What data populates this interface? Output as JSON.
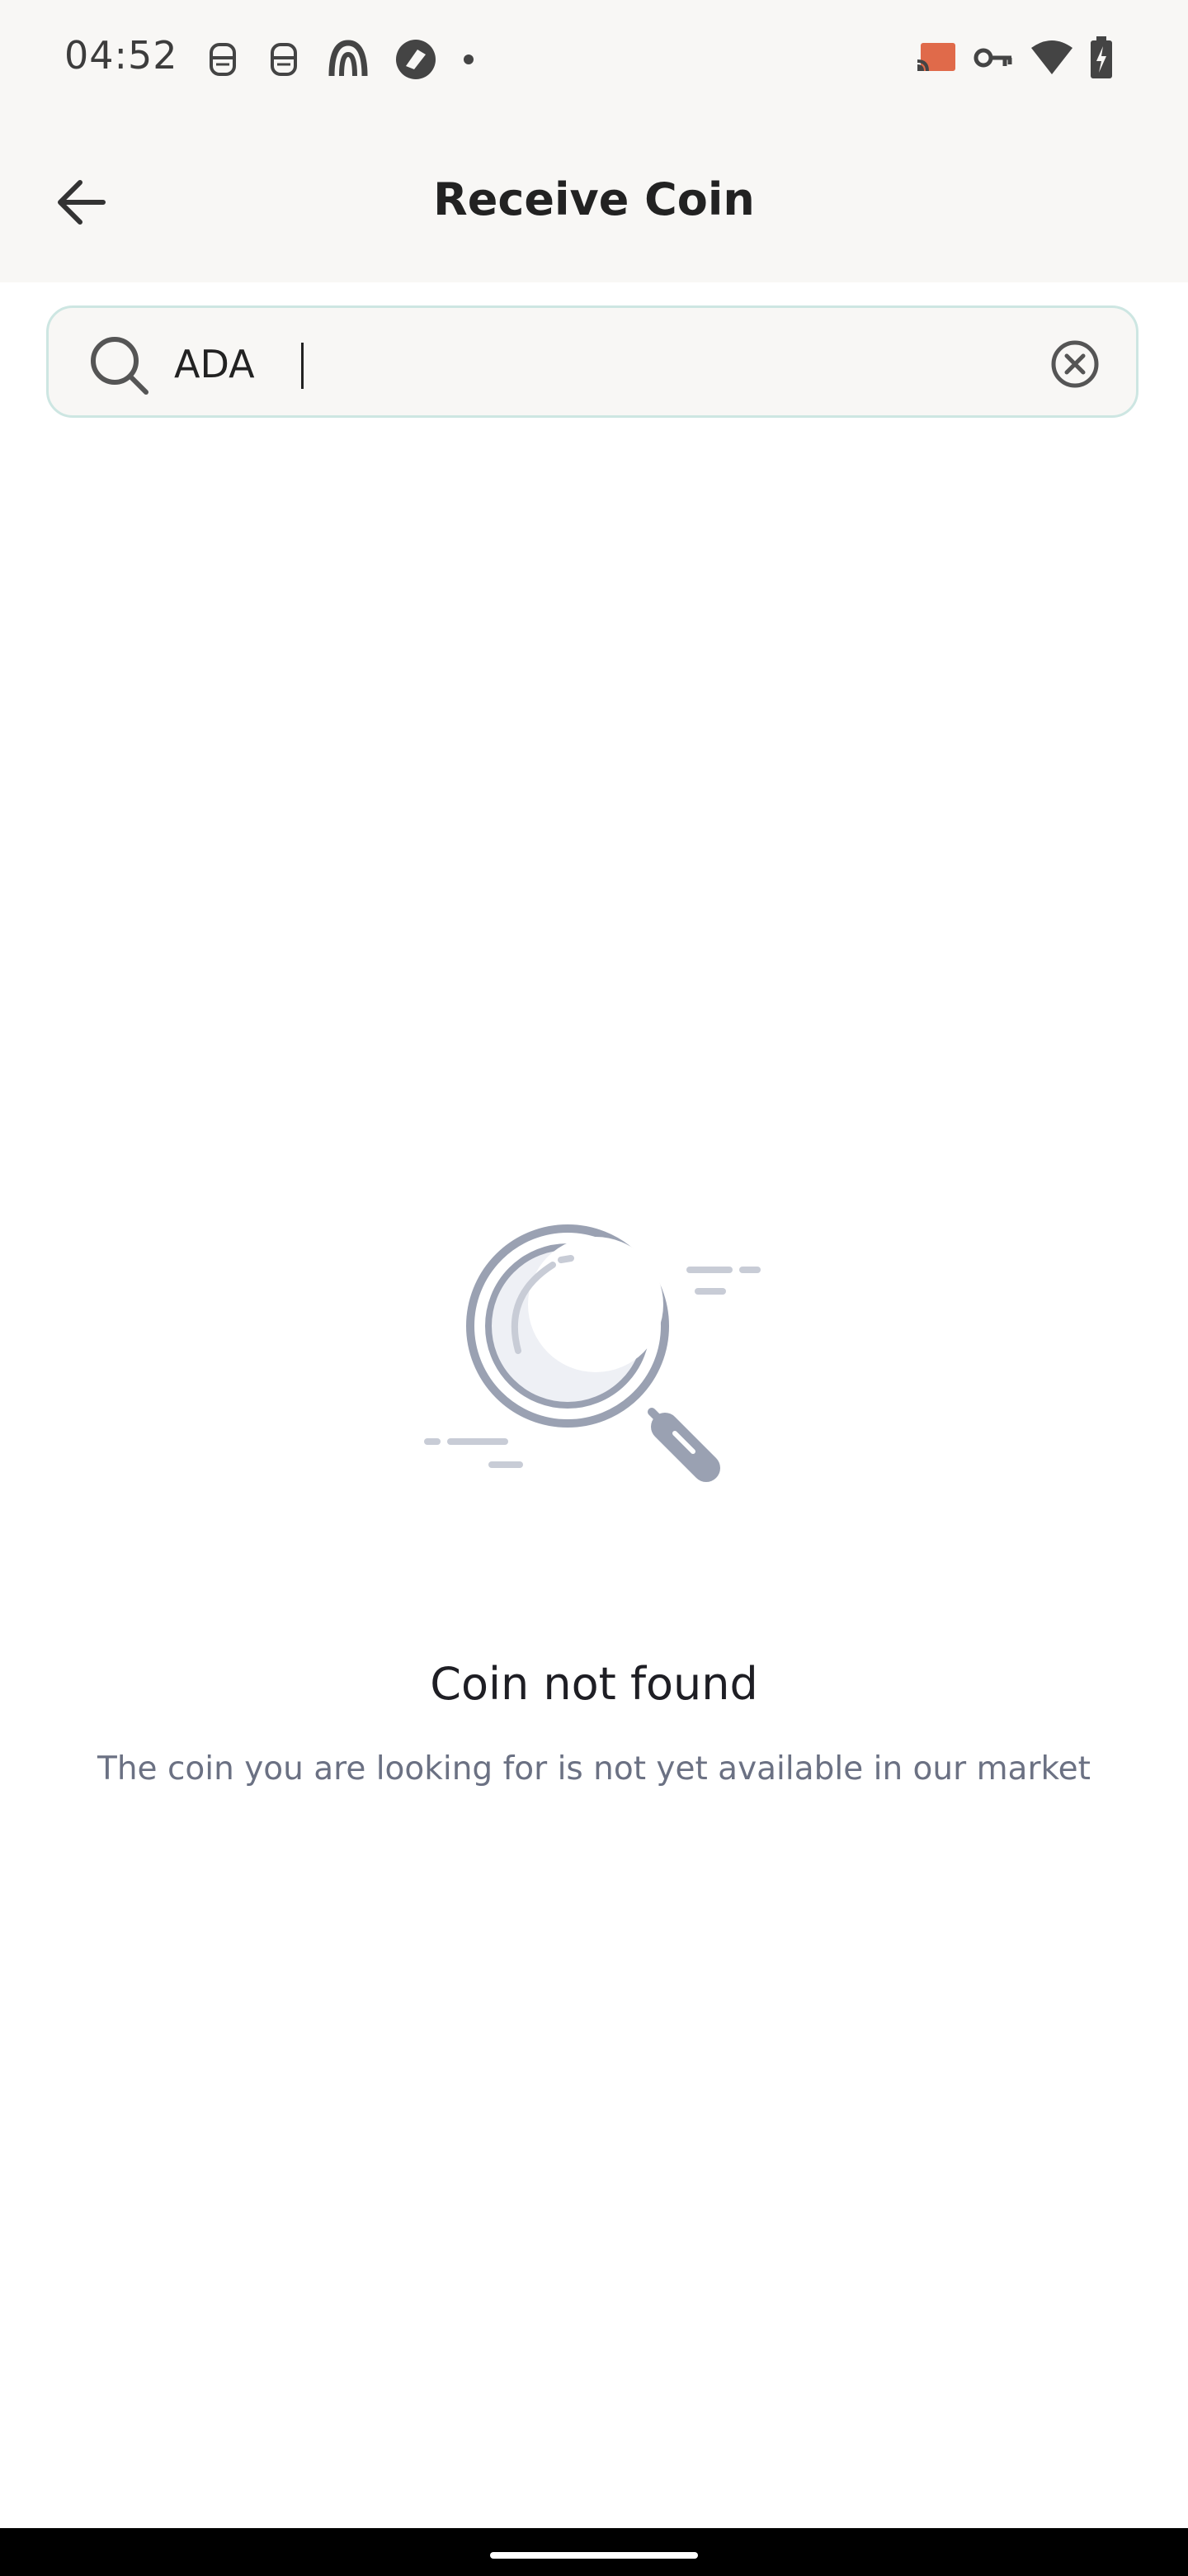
{
  "status_bar": {
    "time": "04:52",
    "left_icons": [
      "robot-icon",
      "robot-icon",
      "app-icon",
      "app-icon",
      "dot-icon"
    ],
    "right_icons": [
      "cast-icon",
      "vpn-key-icon",
      "wifi-icon",
      "battery-charging-icon"
    ]
  },
  "app_bar": {
    "title": "Receive Coin",
    "back_icon": "arrow-left-icon"
  },
  "search": {
    "value": "ADA",
    "placeholder": "",
    "icon": "search-icon",
    "clear_icon": "close-circle-icon"
  },
  "empty_state": {
    "icon": "magnifier-illustration-icon",
    "title": "Coin not found",
    "subtitle": "The coin you are looking for is not yet available in our market"
  },
  "colors": {
    "appbar_bg": "#f8f7f5",
    "search_border": "#cde6e2",
    "title": "#222222",
    "subtitle": "#6b7183",
    "illustration": "#9aa1b2"
  }
}
